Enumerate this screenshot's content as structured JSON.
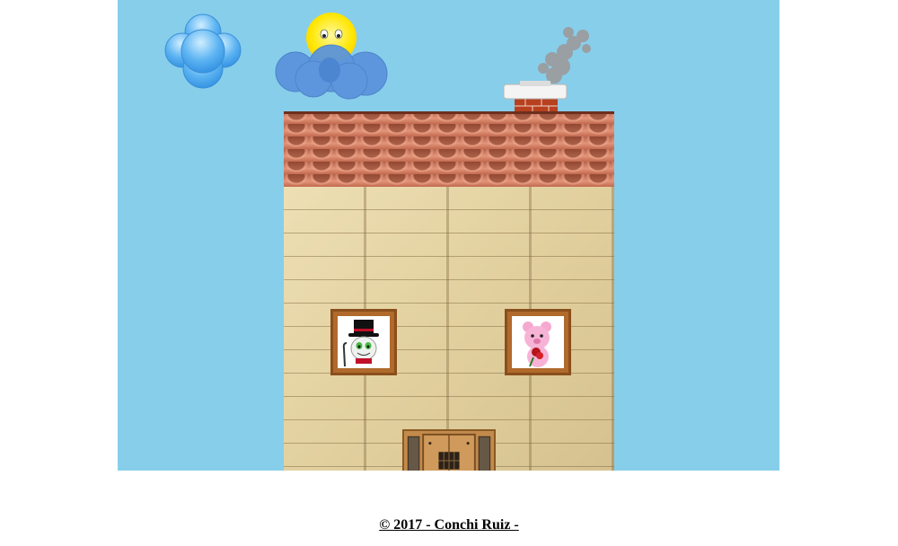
{
  "scene": {
    "sky_color": "#87ceeb",
    "icons": {
      "cloud": "cloud-icon",
      "sun": "sun-icon",
      "chimney": "chimney-icon",
      "door": "door-icon"
    },
    "characters": {
      "left_window": "top-hat-ghost-icon",
      "right_window": "pink-bear-icon"
    }
  },
  "footer": {
    "copyright": "© 2017 - Conchi Ruiz -"
  }
}
